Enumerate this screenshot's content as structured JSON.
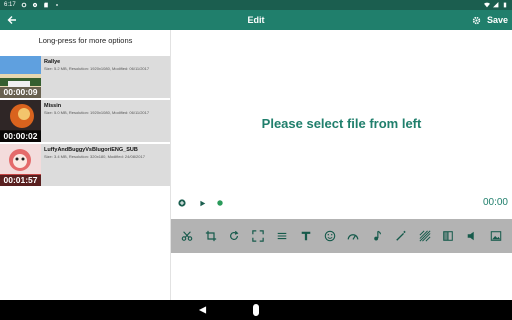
{
  "status_bar": {
    "time": "6:17"
  },
  "app_bar": {
    "title": "Edit",
    "save_label": "Save"
  },
  "left_panel": {
    "hint": "Long-press for more options",
    "files": [
      {
        "name": "Rallye",
        "meta": "Size: 5.2 MB, Resolution: 1920x1080, Modified: 06/11/2017",
        "duration": "00:00:09"
      },
      {
        "name": "Missin",
        "meta": "Size: 5.0 MB, Resolution: 1920x1080, Modified: 06/11/2017",
        "duration": "00:00:02"
      },
      {
        "name": "LuffyAndBuggyVsBlugoriENG_SUB",
        "meta": "Size: 3.4 MB, Resolution: 320x180, Modified: 24/08/2017",
        "duration": "00:01:57"
      }
    ]
  },
  "main": {
    "placeholder": "Please select file from left",
    "time_display": "00:00"
  },
  "toolbar": {
    "tools": [
      "scissors-icon",
      "crop-icon",
      "rotate-icon",
      "fullscreen-icon",
      "filters-icon",
      "text-icon",
      "emoji-icon",
      "speed-icon",
      "music-icon",
      "magic-icon",
      "stripes-icon",
      "mirror-icon",
      "volume-icon",
      "image-icon"
    ]
  },
  "colors": {
    "accent": "#207f6c",
    "statusbar": "#1b5e4f",
    "toolbar_bg": "#b3b3b3",
    "item_bg": "#dcdcdc"
  }
}
